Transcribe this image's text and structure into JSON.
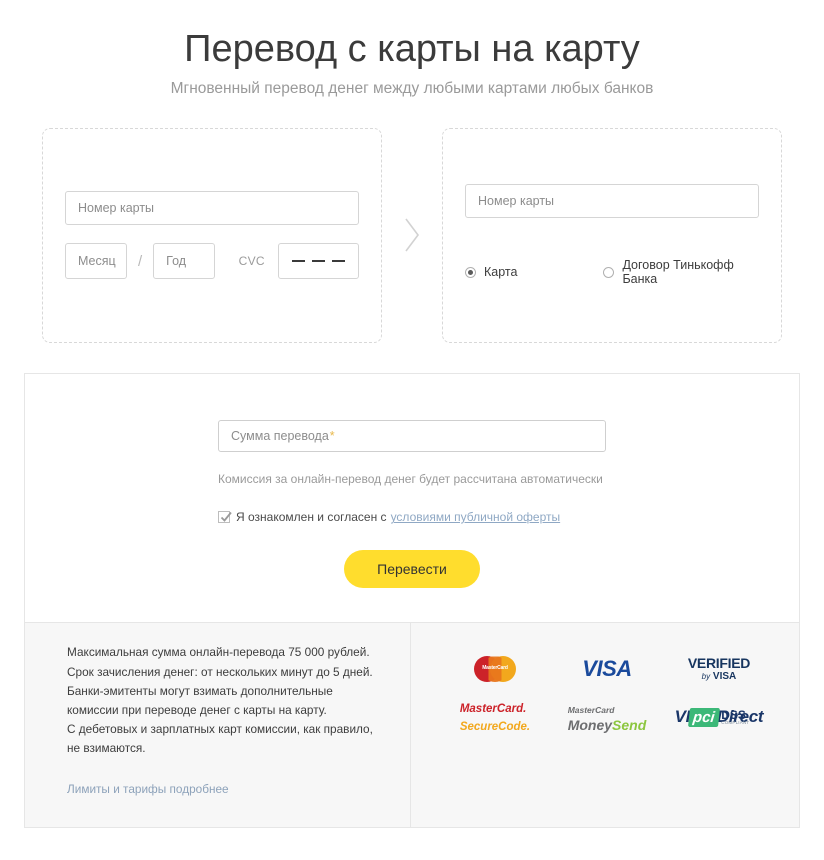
{
  "header": {
    "title": "Перевод с карты на карту",
    "subtitle": "Мгновенный перевод денег между любыми картами любых банков"
  },
  "source_card": {
    "card_number_placeholder": "Номер карты",
    "month_placeholder": "Месяц",
    "separator": "/",
    "year_placeholder": "Год",
    "cvc_label": "CVC"
  },
  "target_card": {
    "card_number_placeholder": "Номер карты",
    "options": [
      {
        "label": "Карта",
        "selected": true
      },
      {
        "label": "Договор Тинькофф Банка",
        "selected": false
      }
    ]
  },
  "transfer": {
    "amount_placeholder": "Сумма перевода",
    "amount_required_mark": "*",
    "commission_note": "Комиссия за онлайн-перевод денег будет рассчитана автоматически",
    "agree_text": "Я ознакомлен и согласен с",
    "agree_link": "условиями публичной оферты",
    "agree_checked": true,
    "submit_label": "Перевести"
  },
  "footer": {
    "info_text": "Максимальная сумма онлайн-перевода 75 000 рублей.\nСрок зачисления денег: от нескольких минут до 5 дней.\nБанки-эмитенты могут взимать дополнительные комиссии при переводе денег с карты на карту.\nС дебетовых и зарплатных карт комиссии, как правило, не взимаются.",
    "link": "Лимиты и тарифы подробнее",
    "logos": [
      {
        "name": "mastercard",
        "text": "MasterCard"
      },
      {
        "name": "visa",
        "text": "VISA"
      },
      {
        "name": "verified-by-visa",
        "line1": "VERIFIED",
        "line2_prefix": "by",
        "line2": "VISA"
      },
      {
        "name": "mastercard-securecode",
        "line1": "MasterCard.",
        "line2": "SecureCode."
      },
      {
        "name": "mastercard-moneysend",
        "line1": "MasterCard",
        "line2a": "Money",
        "line2b": "Send"
      },
      {
        "name": "visa-direct",
        "text": "VISA Direct"
      },
      {
        "name": "pci-dss",
        "badge": "pci",
        "line1": "DSS",
        "line2": "COMPLIANT"
      }
    ]
  },
  "colors": {
    "accent_yellow": "#ffdd2d",
    "link_blue": "#8da2ba",
    "text_dark": "#3b3b3b",
    "text_muted": "#9a9a9a",
    "visa_blue": "#1a4a9c",
    "mastercard_red": "#cc2229",
    "mastercard_yellow": "#f2a81d",
    "pci_green": "#3cb878"
  }
}
